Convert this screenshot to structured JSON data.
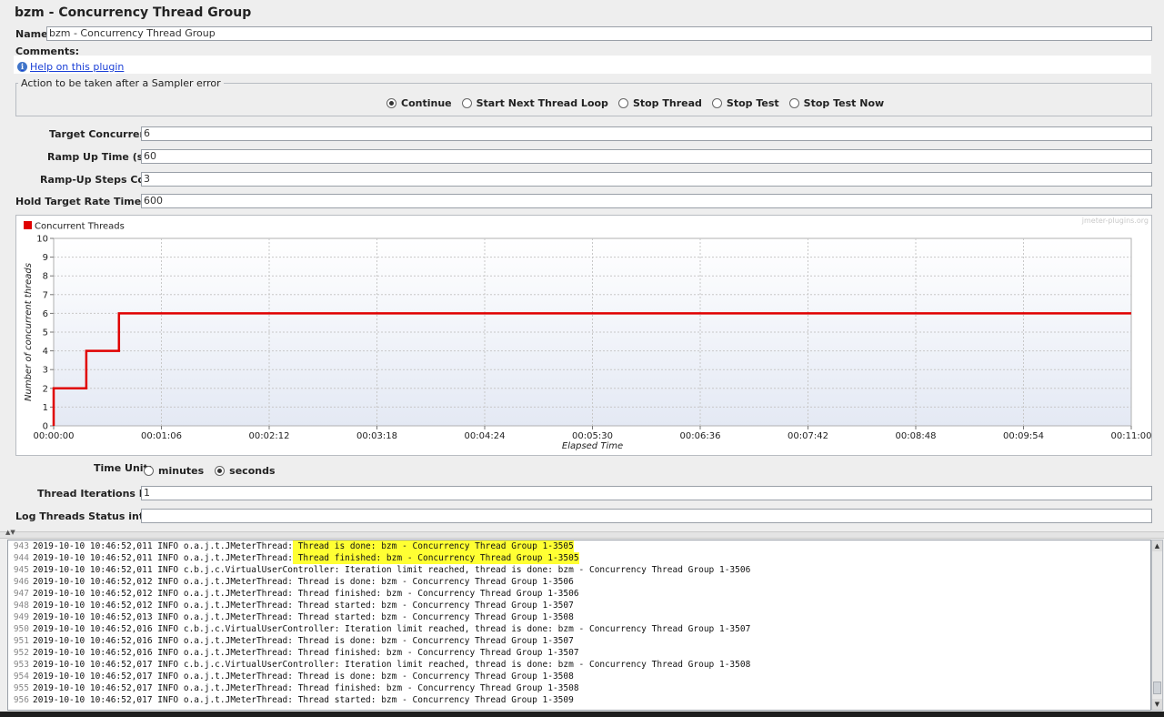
{
  "panel": {
    "title": "bzm - Concurrency Thread Group"
  },
  "name_field": {
    "label": "Name:",
    "value": "bzm - Concurrency Thread Group"
  },
  "comments": {
    "label": "Comments:"
  },
  "help": {
    "label": "Help on this plugin",
    "icon": "info-icon"
  },
  "sampler_error": {
    "title": "Action to be taken after a Sampler error",
    "options": [
      "Continue",
      "Start Next Thread Loop",
      "Stop Thread",
      "Stop Test",
      "Stop Test Now"
    ],
    "selected": "Continue"
  },
  "params": {
    "target_concurrency": {
      "label": "Target Concurrency:",
      "value": "6"
    },
    "ramp_up_time": {
      "label": "Ramp Up Time (sec):",
      "value": "60"
    },
    "ramp_up_steps": {
      "label": "Ramp-Up Steps Count:",
      "value": "3"
    },
    "hold_time": {
      "label": "Hold Target Rate Time (sec):",
      "value": "600"
    }
  },
  "chart_data": {
    "type": "line",
    "watermark": "jmeter-plugins.org",
    "xlabel": "Elapsed Time",
    "ylabel": "Number of concurrent threads",
    "ylim": [
      0,
      10
    ],
    "xlim_sec": [
      0,
      660
    ],
    "x_ticks": [
      "00:00:00",
      "00:01:06",
      "00:02:12",
      "00:03:18",
      "00:04:24",
      "00:05:30",
      "00:06:36",
      "00:07:42",
      "00:08:48",
      "00:09:54",
      "00:11:00"
    ],
    "y_ticks": [
      "0",
      "1",
      "2",
      "3",
      "4",
      "5",
      "6",
      "7",
      "8",
      "9",
      "10"
    ],
    "grid": true,
    "legend_position": "top-left",
    "series": [
      {
        "name": "Concurrent Threads",
        "color": "#e00000",
        "x": [
          0,
          0,
          20,
          20,
          40,
          40,
          660
        ],
        "y": [
          0,
          2,
          2,
          4,
          4,
          6,
          6
        ]
      }
    ]
  },
  "time_unit": {
    "label": "Time Unit:",
    "options": [
      "minutes",
      "seconds"
    ],
    "selected": "seconds"
  },
  "iterations": {
    "label": "Thread Iterations Limit:",
    "value": "1"
  },
  "log_file": {
    "label": "Log Threads Status into File:",
    "value": ""
  },
  "log": {
    "lines": [
      {
        "n": "943",
        "pre": "2019-10-10 10:46:52,011 INFO o.a.j.t.JMeterThread:",
        "msg": " Thread is done: bzm - Concurrency Thread Group 1-3505",
        "highlight": true
      },
      {
        "n": "944",
        "pre": "2019-10-10 10:46:52,011 INFO o.a.j.t.JMeterThread:",
        "msg": " Thread finished: bzm - Concurrency Thread Group 1-3505",
        "highlight": true
      },
      {
        "n": "945",
        "pre": "2019-10-10 10:46:52,011 INFO c.b.j.c.VirtualUserController:",
        "msg": " Iteration limit reached, thread is done: bzm - Concurrency Thread Group 1-3506",
        "highlight": false
      },
      {
        "n": "946",
        "pre": "2019-10-10 10:46:52,012 INFO o.a.j.t.JMeterThread:",
        "msg": " Thread is done: bzm - Concurrency Thread Group 1-3506",
        "highlight": false
      },
      {
        "n": "947",
        "pre": "2019-10-10 10:46:52,012 INFO o.a.j.t.JMeterThread:",
        "msg": " Thread finished: bzm - Concurrency Thread Group 1-3506",
        "highlight": false
      },
      {
        "n": "948",
        "pre": "2019-10-10 10:46:52,012 INFO o.a.j.t.JMeterThread:",
        "msg": " Thread started: bzm - Concurrency Thread Group 1-3507",
        "highlight": false
      },
      {
        "n": "949",
        "pre": "2019-10-10 10:46:52,013 INFO o.a.j.t.JMeterThread:",
        "msg": " Thread started: bzm - Concurrency Thread Group 1-3508",
        "highlight": false
      },
      {
        "n": "950",
        "pre": "2019-10-10 10:46:52,016 INFO c.b.j.c.VirtualUserController:",
        "msg": " Iteration limit reached, thread is done: bzm - Concurrency Thread Group 1-3507",
        "highlight": false
      },
      {
        "n": "951",
        "pre": "2019-10-10 10:46:52,016 INFO o.a.j.t.JMeterThread:",
        "msg": " Thread is done: bzm - Concurrency Thread Group 1-3507",
        "highlight": false
      },
      {
        "n": "952",
        "pre": "2019-10-10 10:46:52,016 INFO o.a.j.t.JMeterThread:",
        "msg": " Thread finished: bzm - Concurrency Thread Group 1-3507",
        "highlight": false
      },
      {
        "n": "953",
        "pre": "2019-10-10 10:46:52,017 INFO c.b.j.c.VirtualUserController:",
        "msg": " Iteration limit reached, thread is done: bzm - Concurrency Thread Group 1-3508",
        "highlight": false
      },
      {
        "n": "954",
        "pre": "2019-10-10 10:46:52,017 INFO o.a.j.t.JMeterThread:",
        "msg": " Thread is done: bzm - Concurrency Thread Group 1-3508",
        "highlight": false
      },
      {
        "n": "955",
        "pre": "2019-10-10 10:46:52,017 INFO o.a.j.t.JMeterThread:",
        "msg": " Thread finished: bzm - Concurrency Thread Group 1-3508",
        "highlight": false
      },
      {
        "n": "956",
        "pre": "2019-10-10 10:46:52,017 INFO o.a.j.t.JMeterThread:",
        "msg": " Thread started: bzm - Concurrency Thread Group 1-3509",
        "highlight": false
      }
    ]
  }
}
